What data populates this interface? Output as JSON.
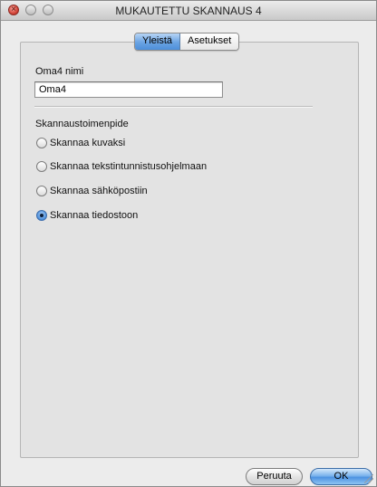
{
  "window": {
    "title": "MUKAUTETTU SKANNAUS 4"
  },
  "tabs": [
    {
      "label": "Yleistä",
      "selected": true
    },
    {
      "label": "Asetukset",
      "selected": false
    }
  ],
  "general": {
    "name_label": "Oma4 nimi",
    "name_value": "Oma4",
    "action_group_label": "Skannaustoimenpide",
    "actions": [
      {
        "label": "Skannaa kuvaksi",
        "checked": false
      },
      {
        "label": "Skannaa tekstintunnistusohjelmaan",
        "checked": false
      },
      {
        "label": "Skannaa sähköpostiin",
        "checked": false
      },
      {
        "label": "Skannaa tiedostoon",
        "checked": true
      }
    ]
  },
  "footer": {
    "cancel_label": "Peruuta",
    "ok_label": "OK"
  },
  "colors": {
    "accent": "#4d8fdb",
    "close_button": "#d4463a"
  },
  "icons": {
    "close": "close-icon",
    "minimize": "minimize-icon",
    "zoom": "zoom-icon"
  }
}
